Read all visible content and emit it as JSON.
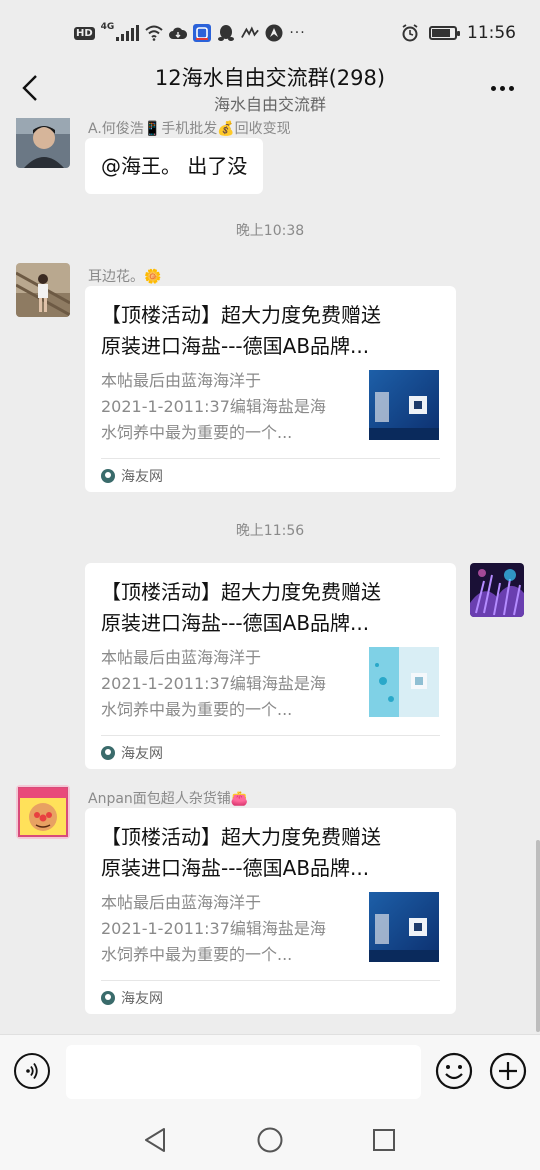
{
  "status_bar": {
    "time": "11:56",
    "hd_label": "HD",
    "network_label": "4G",
    "icons": [
      "hd-icon",
      "signal-icon",
      "wifi-icon",
      "cloud-icon",
      "app-icon",
      "qq-icon",
      "notification-icon",
      "navigation-icon",
      "more-dots-icon",
      "alarm-icon",
      "battery-icon"
    ]
  },
  "header": {
    "title": "12海水自由交流群(298)",
    "subtitle": "海水自由交流群"
  },
  "messages": [
    {
      "type": "text",
      "sender": "A.何俊浩📱手机批发💰回收变现",
      "text": "@海王。 出了没"
    },
    {
      "type": "timestamp",
      "text": "晚上10:38"
    },
    {
      "type": "card",
      "sender": "耳边花。🌼",
      "title_line1": "【顶楼活动】超大力度免费赠送",
      "title_line2": "原装进口海盐---德国AB品牌...",
      "desc_line1": "本帖最后由蓝海海洋于",
      "desc_line2": "2021-1-2011:37编辑海盐是海",
      "desc_line3": "水饲养中最为重要的一个...",
      "source": "海友网"
    },
    {
      "type": "timestamp",
      "text": "晚上11:56"
    },
    {
      "type": "card_self",
      "title_line1": "【顶楼活动】超大力度免费赠送",
      "title_line2": "原装进口海盐---德国AB品牌...",
      "desc_line1": "本帖最后由蓝海海洋于",
      "desc_line2": "2021-1-2011:37编辑海盐是海",
      "desc_line3": "水饲养中最为重要的一个...",
      "source": "海友网"
    },
    {
      "type": "card",
      "sender": "Anpan面包超人杂货铺👛",
      "title_line1": "【顶楼活动】超大力度免费赠送",
      "title_line2": "原装进口海盐---德国AB品牌...",
      "desc_line1": "本帖最后由蓝海海洋于",
      "desc_line2": "2021-1-2011:37编辑海盐是海",
      "desc_line3": "水饲养中最为重要的一个...",
      "source": "海友网"
    }
  ],
  "input_bar": {
    "placeholder": "",
    "icons": [
      "voice-icon",
      "emoji-icon",
      "plus-icon"
    ]
  },
  "nav_bar": {
    "icons": [
      "back-triangle-icon",
      "home-circle-icon",
      "recents-square-icon"
    ]
  },
  "colors": {
    "background": "#ededed",
    "bubble": "#ffffff",
    "muted_text": "#8a8a8a"
  }
}
